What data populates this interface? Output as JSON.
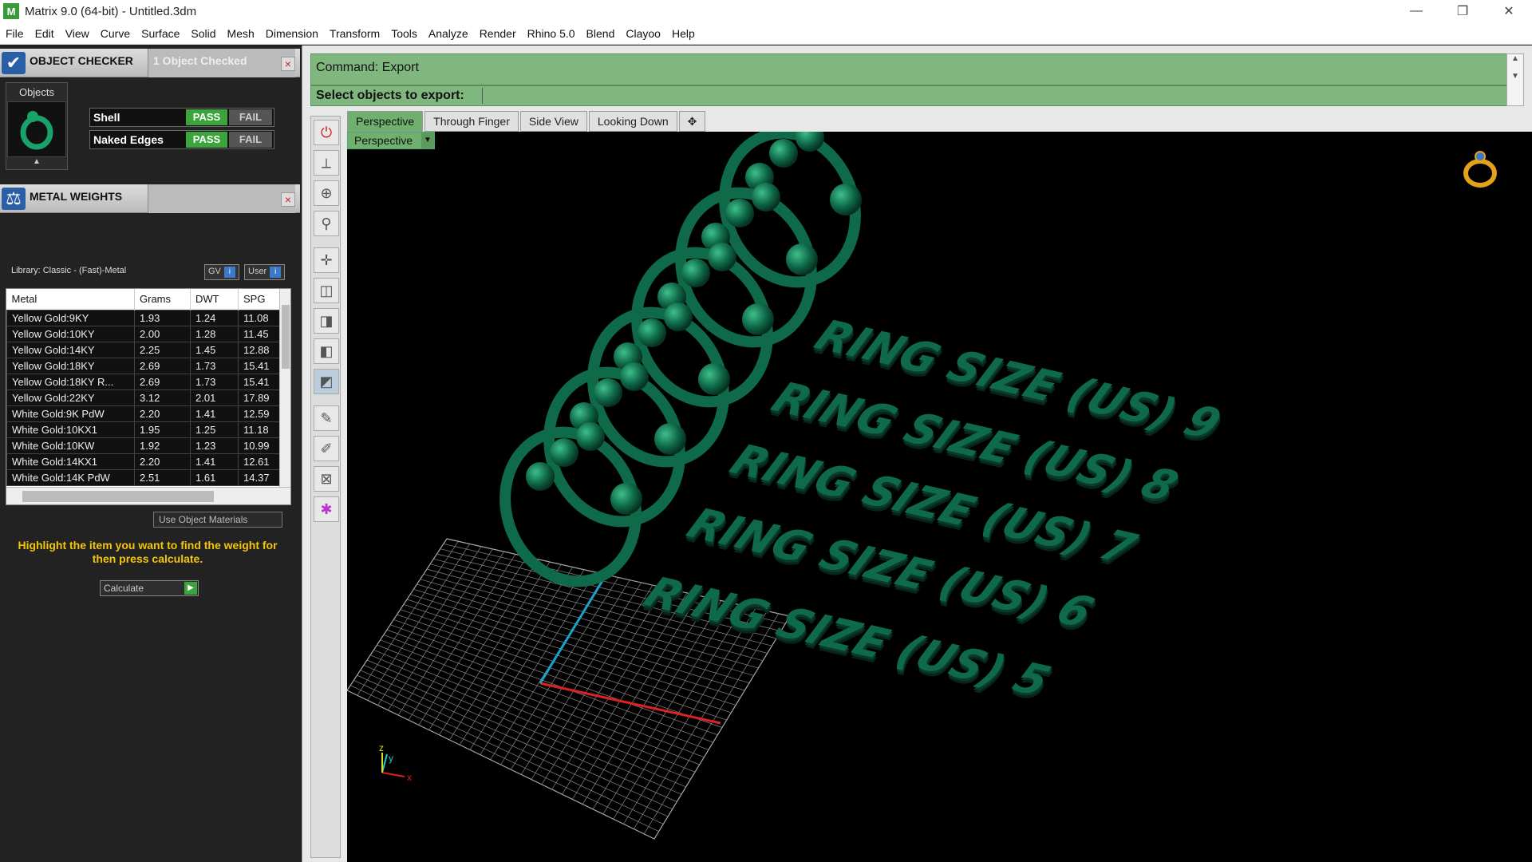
{
  "window": {
    "title": "Matrix 9.0 (64-bit) - Untitled.3dm",
    "minimize": "—",
    "restore": "❐",
    "close": "✕"
  },
  "menu": [
    "File",
    "Edit",
    "View",
    "Curve",
    "Surface",
    "Solid",
    "Mesh",
    "Dimension",
    "Transform",
    "Tools",
    "Analyze",
    "Render",
    "Rhino 5.0",
    "Blend",
    "Clayoo",
    "Help"
  ],
  "object_checker": {
    "title": "OBJECT CHECKER",
    "status": "1  Object Checked",
    "objects_label": "Objects",
    "checks": [
      {
        "label": "Shell",
        "pass": "PASS",
        "fail": "FAIL"
      },
      {
        "label": "Naked Edges",
        "pass": "PASS",
        "fail": "FAIL"
      }
    ]
  },
  "metal_weights": {
    "title": "METAL WEIGHTS",
    "library": "Library: Classic - (Fast)-Metal",
    "gv_label": "GV",
    "user_label": "User",
    "columns": [
      "Metal",
      "Grams",
      "DWT",
      "SPG"
    ],
    "rows": [
      [
        "Yellow Gold:9KY",
        "1.93",
        "1.24",
        "11.08"
      ],
      [
        "Yellow Gold:10KY",
        "2.00",
        "1.28",
        "11.45"
      ],
      [
        "Yellow Gold:14KY",
        "2.25",
        "1.45",
        "12.88"
      ],
      [
        "Yellow Gold:18KY",
        "2.69",
        "1.73",
        "15.41"
      ],
      [
        "Yellow Gold:18KY R...",
        "2.69",
        "1.73",
        "15.41"
      ],
      [
        "Yellow Gold:22KY",
        "3.12",
        "2.01",
        "17.89"
      ],
      [
        "White Gold:9K PdW",
        "2.20",
        "1.41",
        "12.59"
      ],
      [
        "White Gold:10KX1",
        "1.95",
        "1.25",
        "11.18"
      ],
      [
        "White Gold:10KW",
        "1.92",
        "1.23",
        "10.99"
      ],
      [
        "White Gold:14KX1",
        "2.20",
        "1.41",
        "12.61"
      ],
      [
        "White Gold:14K PdW",
        "2.51",
        "1.61",
        "14.37"
      ]
    ],
    "use_object_materials": "Use Object Materials",
    "hint": "Highlight the item you want to find the weight for then press calculate.",
    "calculate": "Calculate"
  },
  "command": {
    "line1": "Command: Export",
    "line2": "Select objects to export:"
  },
  "view_tabs": [
    "Perspective",
    "Through Finger",
    "Side View",
    "Looking Down",
    "✥"
  ],
  "viewport": {
    "label": "Perspective",
    "ring_texts": [
      "RING SIZE (US)   9",
      "RING SIZE (US)   8",
      "RING SIZE (US)   7",
      "RING SIZE (US)   6",
      "RING SIZE (US)   5"
    ],
    "axis_x": "x",
    "axis_y": "y",
    "axis_z": "z"
  },
  "colors": {
    "accent_green": "#6fb06f",
    "ring_green": "#0f6a4a",
    "pass_green": "#3ba53b",
    "hint_yellow": "#f4c60b"
  }
}
